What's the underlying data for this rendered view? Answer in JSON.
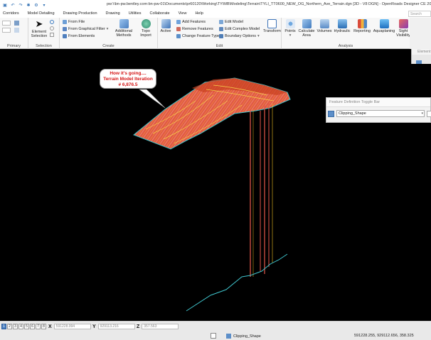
{
  "window": {
    "title": "pw:\\\\bn-pw.bentley.com:bn-pw-01\\Documents\\pr60120\\Working\\TY\\MB\\Modeling\\Terrain\\TYLI_TT0600_NEW_OG_Northern_Ave_Terrain.dgn [3D - V8 DGN] - OpenRoads Designer CE 2023"
  },
  "ribbon_tabs": [
    "Corridors",
    "Model Detailing",
    "Drawing Production",
    "Drawing",
    "Utilities",
    "Collaborate",
    "View",
    "Help"
  ],
  "search_ribbon_placeholder": "Search Ribbon",
  "groups": {
    "primary": "Primary",
    "selection": "Selection",
    "create": "Create",
    "edit": "Edit",
    "analysis": "Analysis"
  },
  "selection": {
    "element_selection": "Element Selection"
  },
  "create": {
    "from_file": "From File",
    "from_graphical_filter": "From Graphical Filter",
    "from_elements": "From Elements",
    "additional_methods": "Additional Methods",
    "topo_import": "Topo Import"
  },
  "edit": {
    "active": "Active",
    "add_features": "Add Features",
    "remove_features": "Remove Features",
    "change_feature_type": "Change Feature Type",
    "edit_model": "Edit Model",
    "edit_complex_model": "Edit Complex Model",
    "boundary_options": "Boundary Options",
    "transform": "Transform"
  },
  "analysis": {
    "points": "Points",
    "calculate_area": "Calculate Area",
    "volumes": "Volumes",
    "hydraulic": "Hydraulic",
    "reporting": "Reporting",
    "aquaplaning": "Aquaplaning",
    "sight_visibility": "Sight Visibility"
  },
  "side_panel": {
    "header": "Element"
  },
  "callout": {
    "line1": "How it's going....",
    "line2": "Terrain Model Iteration",
    "line3": "# 6,876.5"
  },
  "feature_toggle_bar": {
    "title": "Feature Definition Toggle Bar",
    "selected": "Clipping_Shape"
  },
  "status_bar": {
    "views": [
      "1",
      "2",
      "3",
      "4",
      "5",
      "6",
      "7",
      "8"
    ],
    "active_view": "1",
    "x_label": "X",
    "x_value": "591228.994",
    "y_label": "Y",
    "y_value": "929113.216",
    "z_label": "Z",
    "z_value": "357.563",
    "element": "Clipping_Shape",
    "coordinates": "591228.255, 929112.656, 358.325"
  },
  "colors": {
    "terrain_fill": "#e2564a",
    "terrain_lines": "#f2c320",
    "edge_line": "#3fc4cc",
    "callout_text": "#d41414",
    "accent": "#1a5fa8"
  }
}
